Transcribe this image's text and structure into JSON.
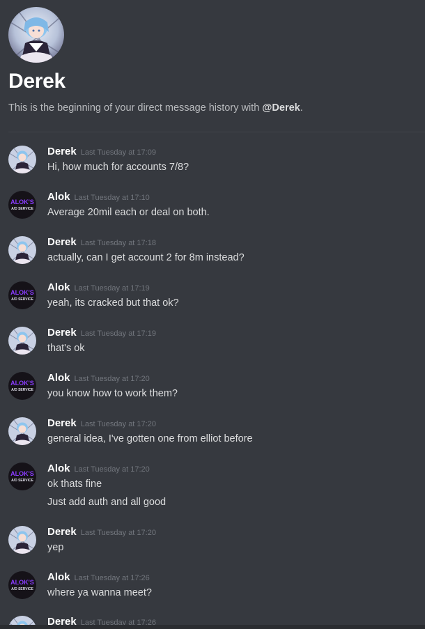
{
  "profile": {
    "name": "Derek",
    "intro_prefix": "This is the beginning of your direct message history with ",
    "intro_mention": "@Derek",
    "intro_suffix": "."
  },
  "colors": {
    "background": "#36393f",
    "author_name": "#ffffff",
    "timestamp": "#72767d",
    "message_text": "#dcddde",
    "alok_avatar_accent": "#8a3cff"
  },
  "messages": [
    {
      "author": "Derek",
      "time": "Last Tuesday at 17:09",
      "lines": [
        "Hi, how much for accounts 7/8?"
      ],
      "avatar": "derek-avatar"
    },
    {
      "author": "Alok",
      "time": "Last Tuesday at 17:10",
      "lines": [
        "Average 20mil each or deal on both."
      ],
      "avatar": "alok-avatar",
      "avatar_text": [
        "ALOK'S",
        "A/D SERVICE"
      ]
    },
    {
      "author": "Derek",
      "time": "Last Tuesday at 17:18",
      "lines": [
        "actually, can I get account 2 for 8m instead?"
      ],
      "avatar": "derek-avatar"
    },
    {
      "author": "Alok",
      "time": "Last Tuesday at 17:19",
      "lines": [
        "yeah, its cracked but that ok?"
      ],
      "avatar": "alok-avatar",
      "avatar_text": [
        "ALOK'S",
        "A/D SERVICE"
      ]
    },
    {
      "author": "Derek",
      "time": "Last Tuesday at 17:19",
      "lines": [
        "that's ok"
      ],
      "avatar": "derek-avatar"
    },
    {
      "author": "Alok",
      "time": "Last Tuesday at 17:20",
      "lines": [
        "you know how to work them?"
      ],
      "avatar": "alok-avatar",
      "avatar_text": [
        "ALOK'S",
        "A/D SERVICE"
      ]
    },
    {
      "author": "Derek",
      "time": "Last Tuesday at 17:20",
      "lines": [
        "general idea, I've gotten one from elliot before"
      ],
      "avatar": "derek-avatar"
    },
    {
      "author": "Alok",
      "time": "Last Tuesday at 17:20",
      "lines": [
        "ok thats fine",
        "Just add auth and all good"
      ],
      "avatar": "alok-avatar",
      "avatar_text": [
        "ALOK'S",
        "A/D SERVICE"
      ]
    },
    {
      "author": "Derek",
      "time": "Last Tuesday at 17:20",
      "lines": [
        "yep"
      ],
      "avatar": "derek-avatar"
    },
    {
      "author": "Alok",
      "time": "Last Tuesday at 17:26",
      "lines": [
        "where ya wanna meet?"
      ],
      "avatar": "alok-avatar",
      "avatar_text": [
        "ALOK'S",
        "A/D SERVICE"
      ]
    },
    {
      "author": "Derek",
      "time": "Last Tuesday at 17:26",
      "lines": [],
      "avatar": "derek-avatar"
    }
  ]
}
